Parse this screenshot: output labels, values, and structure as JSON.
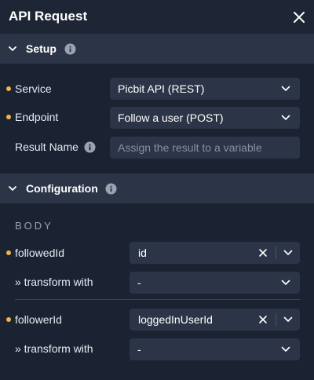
{
  "panel": {
    "title": "API Request"
  },
  "setup": {
    "label": "Setup",
    "service": {
      "label": "Service",
      "value": "Picbit API (REST)"
    },
    "endpoint": {
      "label": "Endpoint",
      "value": "Follow a user (POST)"
    },
    "result_name": {
      "label": "Result Name",
      "value": "",
      "placeholder": "Assign the result to a variable"
    }
  },
  "configuration": {
    "label": "Configuration",
    "body_label": "BODY",
    "params": [
      {
        "label": "followedId",
        "value": "id",
        "transform_label": "» transform with",
        "transform_value": "-"
      },
      {
        "label": "followerId",
        "value": "loggedInUserId",
        "transform_label": "» transform with",
        "transform_value": "-"
      }
    ]
  },
  "colors": {
    "background": "#1b2332",
    "section_bar": "#2b3547",
    "input_bg": "#2c3547",
    "required_dot": "#f0b44a",
    "text": "#ffffff"
  },
  "icons": [
    "close-icon",
    "chevron-down-icon",
    "info-icon",
    "caret-down-icon",
    "clear-icon"
  ]
}
